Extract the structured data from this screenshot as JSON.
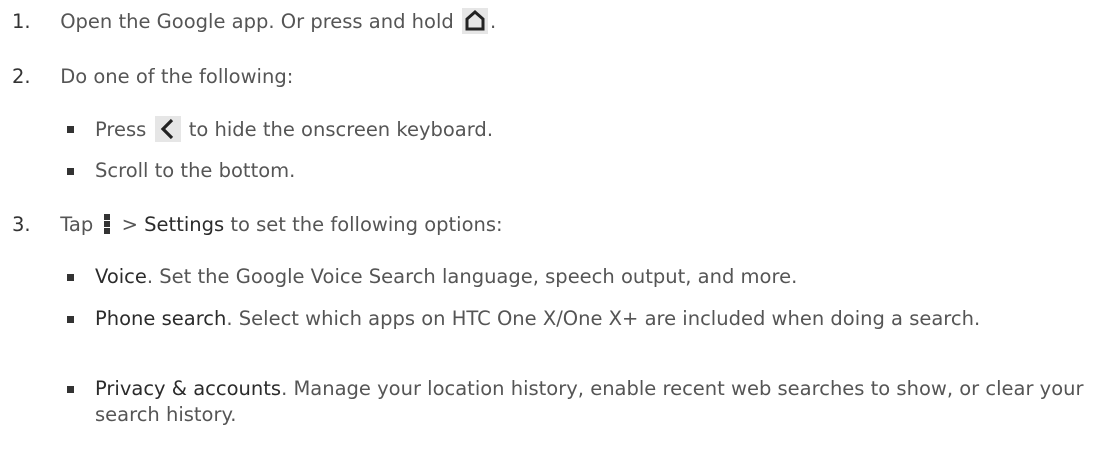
{
  "steps": [
    {
      "num": "1.",
      "text_before": "Open the Google app. Or press and hold",
      "icon": "home-icon",
      "text_after": "."
    },
    {
      "num": "2.",
      "text": "Do one of the following:",
      "bullets": [
        {
          "before": "Press",
          "icon": "back-icon",
          "after": "to hide the onscreen keyboard."
        },
        {
          "text": "Scroll to the bottom."
        }
      ]
    },
    {
      "num": "3.",
      "before": "Tap",
      "icon": "menu-icon",
      "middle": ">",
      "settings": "Settings",
      "after": "to set the following options:",
      "options": [
        {
          "label": "Voice",
          "text": ". Set the Google Voice Search language, speech output, and more."
        },
        {
          "label": "Phone search",
          "text": ". Select which apps on HTC One X/One X+ are included when doing a search."
        },
        {
          "label": "Privacy & accounts",
          "text": ". Manage your location history, enable recent web searches to show, or clear your search history."
        }
      ]
    }
  ],
  "colors": {
    "text": "#555555",
    "number": "#333333",
    "icon_bg": "#e6e6e6"
  }
}
